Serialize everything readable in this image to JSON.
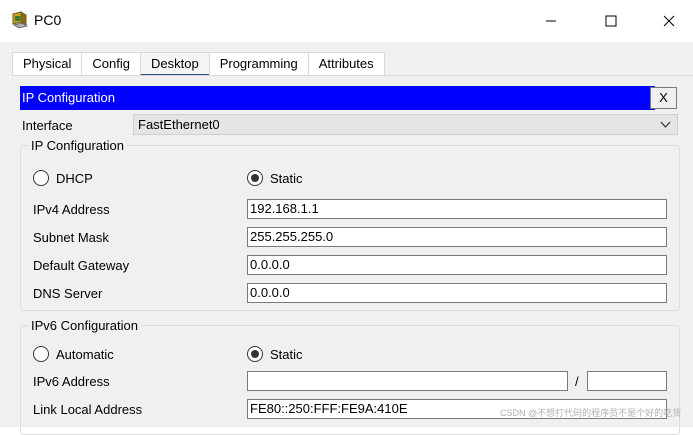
{
  "window": {
    "title": "PC0",
    "icon": "packet-tracer-pc-icon",
    "controls": [
      "minimize-icon",
      "maximize-icon",
      "close-icon"
    ]
  },
  "tabs": [
    "Physical",
    "Config",
    "Desktop",
    "Programming",
    "Attributes"
  ],
  "active_tab": "Desktop",
  "panel": {
    "title": "IP Configuration",
    "close_label": "X",
    "header_color": "#0000ff"
  },
  "interface": {
    "label": "Interface",
    "value": "FastEthernet0"
  },
  "ipv4": {
    "group_title": "IP Configuration",
    "dhcp_label": "DHCP",
    "static_label": "Static",
    "mode": "Static",
    "address_label": "IPv4 Address",
    "address": "192.168.1.1",
    "mask_label": "Subnet Mask",
    "mask": "255.255.255.0",
    "gateway_label": "Default Gateway",
    "gateway": "0.0.0.0",
    "dns_label": "DNS Server",
    "dns": "0.0.0.0"
  },
  "ipv6": {
    "group_title": "IPv6 Configuration",
    "automatic_label": "Automatic",
    "static_label": "Static",
    "mode": "Static",
    "address_label": "IPv6 Address",
    "address": "",
    "prefix_sep": "/",
    "prefix": "",
    "link_local_label": "Link Local Address",
    "link_local": "FE80::250:FFF:FE9A:410E"
  },
  "watermark": "CSDN @不想打代码的程序员不是个好的吃货"
}
